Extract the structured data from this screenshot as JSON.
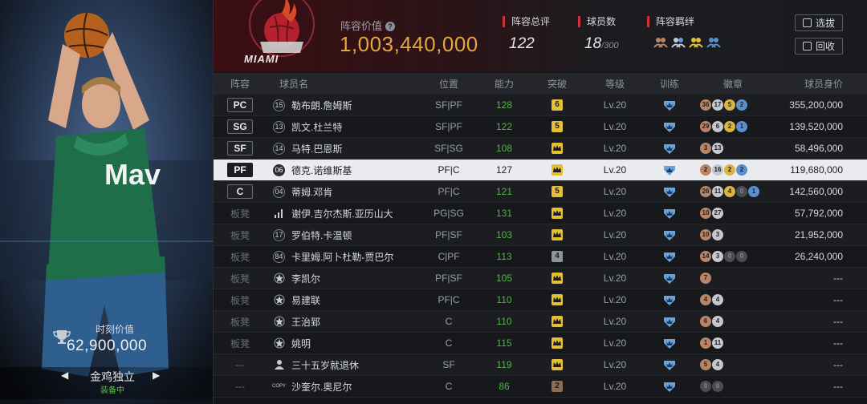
{
  "player_card": {
    "value_label": "时刻价值",
    "value": "62,900,000",
    "skill_name": "金鸡独立",
    "skill_status": "装备中"
  },
  "team": {
    "name": "MIAMI",
    "lineup_value_label": "阵容价值",
    "lineup_value": "1,003,440,000",
    "overall_label": "阵容总评",
    "overall": "122",
    "count_label": "球员数",
    "count": "18",
    "count_max": "/300",
    "bond_label": "阵容羁绊",
    "buttons": {
      "select": "选拔",
      "recycle": "回收"
    },
    "colors": {
      "accent": "#e3a640",
      "brand": "#c0283a"
    }
  },
  "table": {
    "headers": {
      "pos": "阵容",
      "name": "球员名",
      "role": "位置",
      "ovr": "能力",
      "brk": "突破",
      "lvl": "等级",
      "train": "训练",
      "badge": "徽章",
      "value": "球员身价"
    },
    "rows": [
      {
        "pos": "PC",
        "jersey": "15",
        "name": "勒布朗.詹姆斯",
        "role": "SF|PF",
        "ovr": "128",
        "brk": "6",
        "lvl": "Lv.20",
        "badges": [
          [
            "36",
            "b-bronze"
          ],
          [
            "17",
            "b-silver"
          ],
          [
            "5",
            "b-gold"
          ],
          [
            "2",
            "b-blue"
          ]
        ],
        "value": "355,200,000"
      },
      {
        "pos": "SG",
        "jersey": "13",
        "name": "凯文.杜兰特",
        "role": "SF|PF",
        "ovr": "122",
        "brk": "5",
        "lvl": "Lv.20",
        "badges": [
          [
            "29",
            "b-bronze"
          ],
          [
            "6",
            "b-silver"
          ],
          [
            "2",
            "b-gold"
          ],
          [
            "1",
            "b-blue"
          ]
        ],
        "value": "139,520,000"
      },
      {
        "pos": "SF",
        "jersey": "14",
        "name": "马特.巴恩斯",
        "role": "SF|SG",
        "ovr": "108",
        "brk": "",
        "lvl": "Lv.20",
        "badges": [
          [
            "3",
            "b-bronze"
          ],
          [
            "13",
            "b-silver"
          ]
        ],
        "value": "58,496,000"
      },
      {
        "pos": "PF",
        "jersey": "06",
        "name": "德克.诺维斯基",
        "role": "PF|C",
        "ovr": "127",
        "brk": "",
        "lvl": "Lv.20",
        "badges": [
          [
            "2",
            "b-bronze"
          ],
          [
            "16",
            "b-silver"
          ],
          [
            "2",
            "b-gold"
          ],
          [
            "2",
            "b-blue"
          ]
        ],
        "value": "119,680,000"
      },
      {
        "pos": "C",
        "jersey": "04",
        "name": "蒂姆.邓肯",
        "role": "PF|C",
        "ovr": "121",
        "brk": "5",
        "lvl": "Lv.20",
        "badges": [
          [
            "26",
            "b-bronze"
          ],
          [
            "11",
            "b-silver"
          ],
          [
            "4",
            "b-gold"
          ],
          [
            "0",
            "b-dark"
          ],
          [
            "1",
            "b-blue"
          ]
        ],
        "value": "142,560,000"
      },
      {
        "pos": "板凳",
        "jersey": "",
        "name": "谢伊.吉尔杰斯.亚历山大",
        "role": "PG|SG",
        "ovr": "131",
        "brk": "",
        "lvl": "Lv.20",
        "badges": [
          [
            "10",
            "b-bronze"
          ],
          [
            "27",
            "b-silver"
          ]
        ],
        "value": "57,792,000"
      },
      {
        "pos": "板凳",
        "jersey": "17",
        "name": "罗伯特.卡温顿",
        "role": "PF|SF",
        "ovr": "103",
        "brk": "",
        "lvl": "Lv.20",
        "badges": [
          [
            "10",
            "b-bronze"
          ],
          [
            "3",
            "b-silver"
          ]
        ],
        "value": "21,952,000"
      },
      {
        "pos": "板凳",
        "jersey": "84",
        "name": "卡里姆.阿卜杜勒-贾巴尔",
        "role": "C|PF",
        "ovr": "113",
        "brk": "4",
        "lvl": "Lv.20",
        "badges": [
          [
            "14",
            "b-bronze"
          ],
          [
            "3",
            "b-silver"
          ],
          [
            "0",
            "b-dark"
          ],
          [
            "0",
            "b-dark"
          ]
        ],
        "value": "26,240,000"
      },
      {
        "pos": "板凳",
        "jersey": "",
        "name": "李凯尔",
        "role": "PF|SF",
        "ovr": "105",
        "brk": "",
        "lvl": "Lv.20",
        "badges": [
          [
            "7",
            "b-bronze"
          ]
        ],
        "value": "---"
      },
      {
        "pos": "板凳",
        "jersey": "",
        "name": "易建联",
        "role": "PF|C",
        "ovr": "110",
        "brk": "",
        "lvl": "Lv.20",
        "badges": [
          [
            "4",
            "b-bronze"
          ],
          [
            "4",
            "b-silver"
          ]
        ],
        "value": "---"
      },
      {
        "pos": "板凳",
        "jersey": "",
        "name": "王治郅",
        "role": "C",
        "ovr": "110",
        "brk": "",
        "lvl": "Lv.20",
        "badges": [
          [
            "6",
            "b-bronze"
          ],
          [
            "4",
            "b-silver"
          ]
        ],
        "value": "---"
      },
      {
        "pos": "板凳",
        "jersey": "",
        "name": "姚明",
        "role": "C",
        "ovr": "115",
        "brk": "",
        "lvl": "Lv.20",
        "badges": [
          [
            "1",
            "b-bronze"
          ],
          [
            "11",
            "b-silver"
          ]
        ],
        "value": "---"
      },
      {
        "pos": "---",
        "jersey": "",
        "name": "三十五岁就退休",
        "role": "SF",
        "ovr": "119",
        "brk": "",
        "lvl": "Lv.20",
        "badges": [
          [
            "5",
            "b-bronze"
          ],
          [
            "4",
            "b-silver"
          ]
        ],
        "value": "---"
      },
      {
        "pos": "---",
        "jersey": "COPY",
        "name": "沙奎尔.奥尼尔",
        "role": "C",
        "ovr": "86",
        "brk": "2",
        "lvl": "Lv.20",
        "badges": [
          [
            "0",
            "b-dark"
          ],
          [
            "0",
            "b-dark"
          ]
        ],
        "value": "---"
      }
    ]
  }
}
